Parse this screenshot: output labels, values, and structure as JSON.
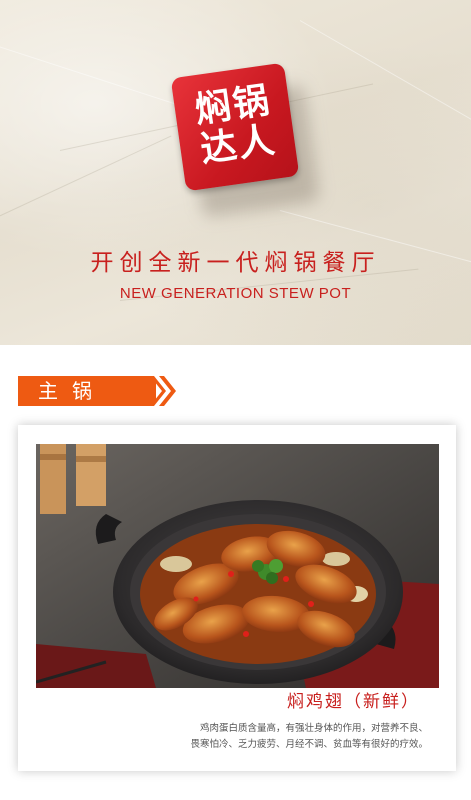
{
  "brand": {
    "logo_line1": "焖锅",
    "logo_line2": "达人"
  },
  "hero": {
    "tagline_cn": "开创全新一代焖锅餐厅",
    "tagline_en": "NEW GENERATION STEW POT"
  },
  "section": {
    "label": "主锅"
  },
  "product": {
    "name": "焖鸡翅（新鲜）",
    "description_line1": "鸡肉蛋白质含量高，有强壮身体的作用，对营养不良、",
    "description_line2": "畏寒怕冷、乏力疲劳、月经不调、贫血等有很好的疗效。"
  },
  "colors": {
    "brand_red": "#c8201e",
    "ribbon_orange": "#ee5a12"
  }
}
